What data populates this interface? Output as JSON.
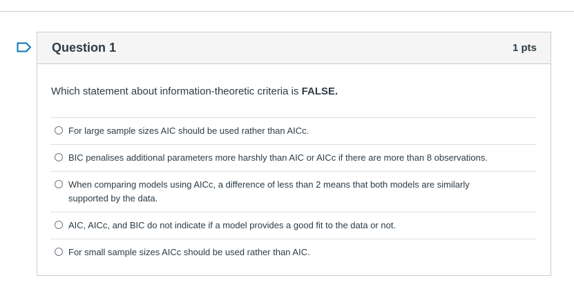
{
  "question": {
    "title": "Question 1",
    "points": "1 pts",
    "text_prefix": "Which statement about information-theoretic criteria is ",
    "text_emphasis": "FALSE.",
    "answers": [
      {
        "label": "For large sample sizes AIC should be used rather than AICc.",
        "selected": false
      },
      {
        "label": "BIC penalises additional parameters more harshly than AIC or AICc if there are more than 8 observations.",
        "selected": false
      },
      {
        "label": "When comparing models using AICc, a difference of less than 2 means that both models are similarly supported by the data.",
        "selected": false
      },
      {
        "label": "AIC, AICc, and BIC do not indicate if a model provides a good fit to the data or not.",
        "selected": false
      },
      {
        "label": "For small sample sizes AICc should be used rather than AIC.",
        "selected": false
      }
    ]
  },
  "flag_icon": "flag-outline-icon",
  "colors": {
    "accent": "#0374b5",
    "border": "#c7cdd1",
    "header_bg": "#f5f5f5",
    "text": "#2d3b45"
  }
}
